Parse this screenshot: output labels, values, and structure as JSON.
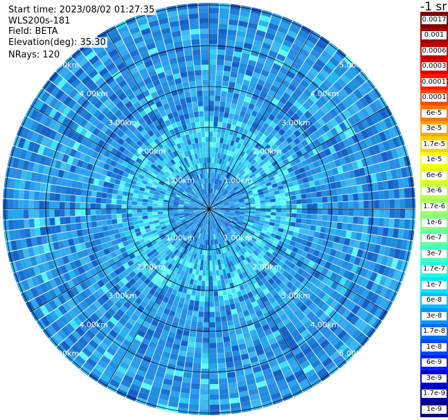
{
  "info": {
    "start_time": "Start time: 2023/08/02 01:27:35",
    "instrument": "WLS200s-181",
    "field": "Field: BETA",
    "elevation": "Elevation(deg): 35.30",
    "nrays": "NRays: 120"
  },
  "unit": "-1 sr",
  "range_labels": [
    "1.00km",
    "2.00km",
    "3.00km",
    "4.00km",
    "5.00km"
  ],
  "colorbar": [
    {
      "label": "0.0017",
      "color": "#7f0000"
    },
    {
      "label": "0.001",
      "color": "#a00000"
    },
    {
      "label": "0.0006",
      "color": "#c40000"
    },
    {
      "label": "0.0003",
      "color": "#e00000"
    },
    {
      "label": "0.00017",
      "color": "#ff1a00"
    },
    {
      "label": "0.0001",
      "color": "#ff4a00"
    },
    {
      "label": "6e-5",
      "color": "#ff7800"
    },
    {
      "label": "3e-5",
      "color": "#ffa600"
    },
    {
      "label": "1.7e-5",
      "color": "#ffd200"
    },
    {
      "label": "1e-5",
      "color": "#ffff00"
    },
    {
      "label": "6e-6",
      "color": "#e0ff20"
    },
    {
      "label": "3e-6",
      "color": "#c0ff40"
    },
    {
      "label": "1.7e-6",
      "color": "#a0ff60"
    },
    {
      "label": "1e-6",
      "color": "#80ff80"
    },
    {
      "label": "6e-7",
      "color": "#60ffa0"
    },
    {
      "label": "3e-7",
      "color": "#40ffc0"
    },
    {
      "label": "1.7e-7",
      "color": "#20ffe0"
    },
    {
      "label": "1e-7",
      "color": "#00e8ff"
    },
    {
      "label": "6e-8",
      "color": "#00c0ff"
    },
    {
      "label": "3e-8",
      "color": "#0098ff"
    },
    {
      "label": "1.7e-8",
      "color": "#0070ff"
    },
    {
      "label": "1e-8",
      "color": "#0048ff"
    },
    {
      "label": "6e-9",
      "color": "#0020ff"
    },
    {
      "label": "3e-9",
      "color": "#0000e0"
    },
    {
      "label": "1.7e-9",
      "color": "#0000b0"
    },
    {
      "label": "1e-9",
      "color": "#000080"
    }
  ]
}
